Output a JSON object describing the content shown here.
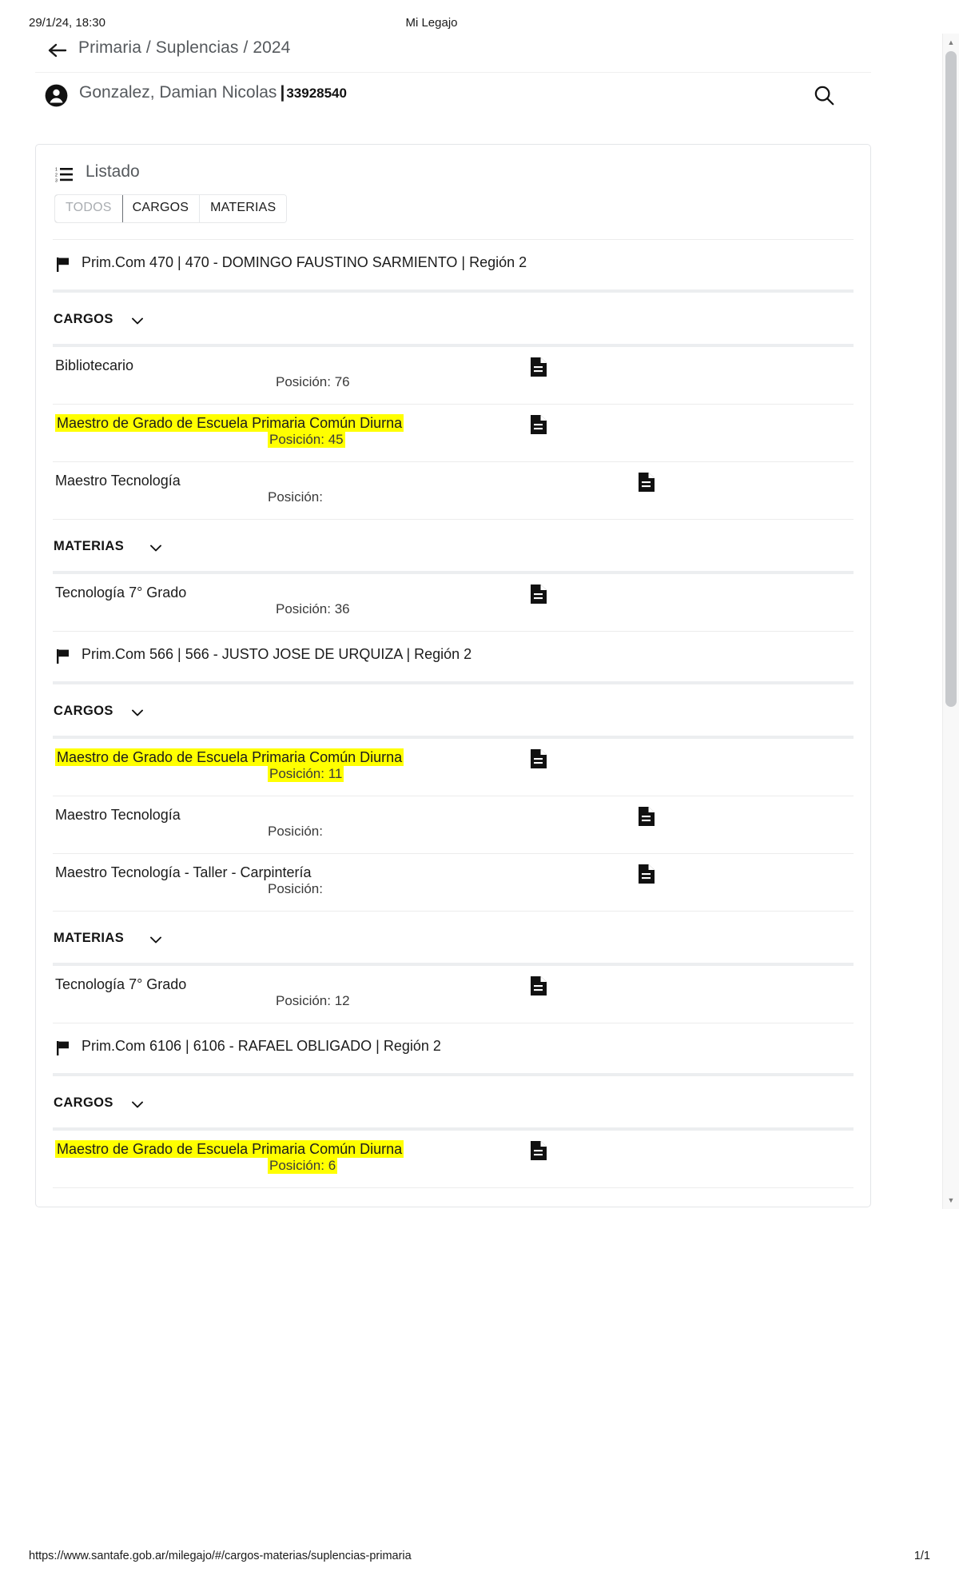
{
  "print": {
    "date": "29/1/24, 18:30",
    "title": "Mi Legajo",
    "url": "https://www.santafe.gob.ar/milegajo/#/cargos-materias/suplencias-primaria",
    "page": "1/1"
  },
  "header": {
    "breadcrumb": "Primaria / Suplencias / 2024",
    "back_icon": "arrow-left-icon",
    "user_name": "Gonzalez, Damian Nicolas",
    "user_separator": "|",
    "user_document": "33928540",
    "search_icon": "search-icon",
    "avatar_icon": "account-circle-icon"
  },
  "card": {
    "title": "Listado",
    "list_icon": "list-numbered-icon",
    "tabs": [
      {
        "label": "TODOS",
        "active": true
      },
      {
        "label": "CARGOS",
        "active": false
      },
      {
        "label": "MATERIAS",
        "active": false
      }
    ]
  },
  "position_label": "Posición:",
  "schools": [
    {
      "name": "Prim.Com 470 | 470 - DOMINGO FAUSTINO SARMIENTO | Región 2",
      "groups": [
        {
          "label": "CARGOS",
          "items": [
            {
              "name": "Bibliotecario",
              "position": "Posición: 76",
              "highlight": false,
              "doc": true
            },
            {
              "name": "Maestro de Grado de Escuela Primaria Común Diurna",
              "position": "Posición: 45",
              "highlight": true,
              "doc": true
            },
            {
              "name": "Maestro Tecnología",
              "position": "Posición:",
              "highlight": false,
              "doc": true
            }
          ]
        },
        {
          "label": "MATERIAS",
          "items": [
            {
              "name": "Tecnología 7° Grado",
              "position": "Posición: 36",
              "highlight": false,
              "doc": true
            }
          ]
        }
      ]
    },
    {
      "name": "Prim.Com 566 | 566 - JUSTO JOSE DE URQUIZA | Región 2",
      "groups": [
        {
          "label": "CARGOS",
          "items": [
            {
              "name": "Maestro de Grado de Escuela Primaria Común Diurna",
              "position": "Posición: 11",
              "highlight": true,
              "doc": true
            },
            {
              "name": "Maestro Tecnología",
              "position": "Posición:",
              "highlight": false,
              "doc": true
            },
            {
              "name": "Maestro Tecnología - Taller - Carpintería",
              "position": "Posición:",
              "highlight": false,
              "doc": true
            }
          ]
        },
        {
          "label": "MATERIAS",
          "items": [
            {
              "name": "Tecnología 7° Grado",
              "position": "Posición: 12",
              "highlight": false,
              "doc": true
            }
          ]
        }
      ]
    },
    {
      "name": "Prim.Com 6106 | 6106 - RAFAEL OBLIGADO | Región 2",
      "groups": [
        {
          "label": "CARGOS",
          "items": [
            {
              "name": "Maestro de Grado de Escuela Primaria Común Diurna",
              "position": "Posición: 6",
              "highlight": true,
              "doc": true
            }
          ]
        }
      ]
    }
  ],
  "colors": {
    "highlight": "#ffff00",
    "muted_text": "#55595d",
    "rule": "#eceef0"
  }
}
